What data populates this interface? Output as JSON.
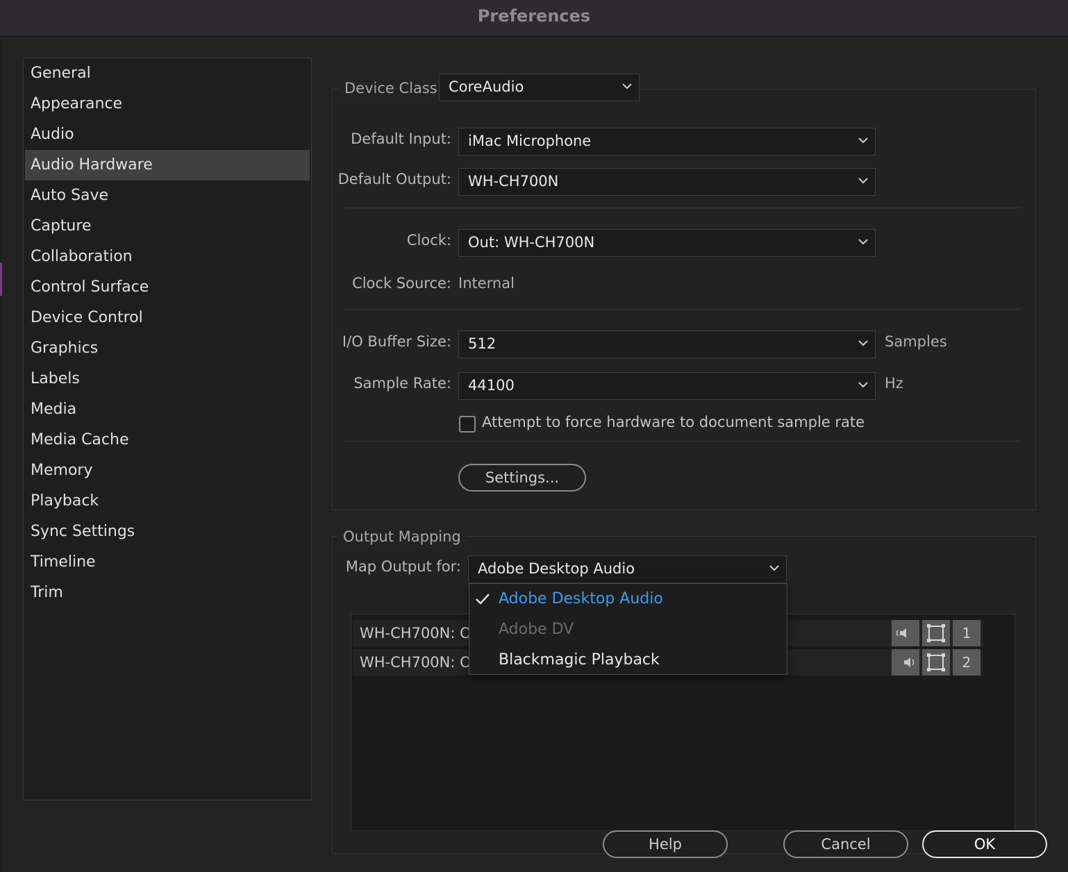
{
  "window": {
    "title": "Preferences"
  },
  "sidebar": {
    "items": [
      {
        "label": "General"
      },
      {
        "label": "Appearance"
      },
      {
        "label": "Audio"
      },
      {
        "label": "Audio Hardware",
        "selected": true
      },
      {
        "label": "Auto Save"
      },
      {
        "label": "Capture"
      },
      {
        "label": "Collaboration"
      },
      {
        "label": "Control Surface"
      },
      {
        "label": "Device Control"
      },
      {
        "label": "Graphics"
      },
      {
        "label": "Labels"
      },
      {
        "label": "Media"
      },
      {
        "label": "Media Cache"
      },
      {
        "label": "Memory"
      },
      {
        "label": "Playback"
      },
      {
        "label": "Sync Settings"
      },
      {
        "label": "Timeline"
      },
      {
        "label": "Trim"
      }
    ]
  },
  "device": {
    "device_class_label": "Device Class:",
    "device_class_value": "CoreAudio",
    "default_input_label": "Default Input:",
    "default_input_value": "iMac Microphone",
    "default_output_label": "Default Output:",
    "default_output_value": "WH-CH700N",
    "clock_label": "Clock:",
    "clock_value": "Out: WH-CH700N",
    "clock_source_label": "Clock Source:",
    "clock_source_value": "Internal",
    "buffer_label": "I/O Buffer Size:",
    "buffer_value": "512",
    "buffer_unit": "Samples",
    "sample_rate_label": "Sample Rate:",
    "sample_rate_value": "44100",
    "sample_rate_unit": "Hz",
    "force_rate_label": "Attempt to force hardware to document sample rate",
    "force_rate_checked": false,
    "settings_button": "Settings..."
  },
  "output_mapping": {
    "group_label": "Output Mapping",
    "map_for_label": "Map Output for:",
    "map_for_value": "Adobe Desktop Audio",
    "rows": [
      {
        "label": "WH-CH700N: Ou",
        "channel": "1"
      },
      {
        "label": "WH-CH700N: Ou",
        "channel": "2"
      }
    ],
    "menu": [
      {
        "label": "Adobe Desktop Audio",
        "checked": true,
        "enabled": true
      },
      {
        "label": "Adobe DV",
        "checked": false,
        "enabled": false
      },
      {
        "label": "Blackmagic Playback",
        "checked": false,
        "enabled": true
      }
    ]
  },
  "footer": {
    "help": "Help",
    "cancel": "Cancel",
    "ok": "OK"
  },
  "colors": {
    "accent_blue": "#3d9bf0",
    "selected_nav": "#404040",
    "disabled_text": "#6a6a6a"
  }
}
